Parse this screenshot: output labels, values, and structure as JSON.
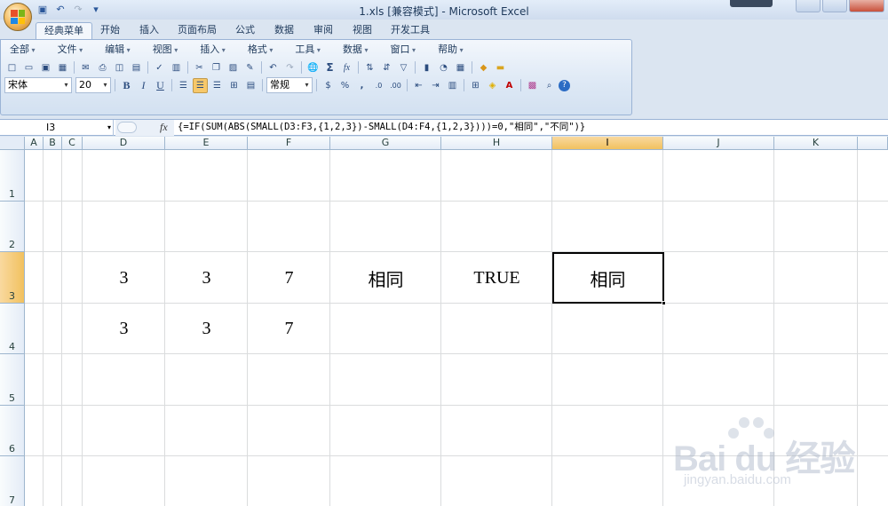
{
  "window": {
    "title": "1.xls  [兼容模式] - Microsoft Excel"
  },
  "ribbon_tabs": [
    "经典菜单",
    "开始",
    "插入",
    "页面布局",
    "公式",
    "数据",
    "审阅",
    "视图",
    "开发工具"
  ],
  "classic_menu": [
    "全部",
    "文件",
    "编辑",
    "视图",
    "插入",
    "格式",
    "工具",
    "数据",
    "窗口",
    "帮助"
  ],
  "format_bar": {
    "font_name": "宋体",
    "font_size": "20",
    "number_format": "常规"
  },
  "formula_bar": {
    "name_box": "I3",
    "fx_label": "fx",
    "formula": "{=IF(SUM(ABS(SMALL(D3:F3,{1,2,3})-SMALL(D4:F4,{1,2,3})))=0,\"相同\",\"不同\")}"
  },
  "sheet": {
    "columns": [
      "A",
      "B",
      "C",
      "D",
      "E",
      "F",
      "G",
      "H",
      "I",
      "J",
      "K"
    ],
    "rows": [
      "1",
      "2",
      "3",
      "4",
      "5",
      "6",
      "7"
    ],
    "selected_cell": "I3",
    "cells": {
      "D3": "3",
      "E3": "3",
      "F3": "7",
      "G3": "相同",
      "H3": "TRUE",
      "I3": "相同",
      "D4": "3",
      "E4": "3",
      "F4": "7"
    }
  },
  "watermark": {
    "brand": "Bai du 经验",
    "url": "jingyan.baidu.com"
  },
  "colors": {
    "ribbon_bg": "#dbe5f1",
    "header_selected": "#f1c15f",
    "grid_line": "#dadcdd"
  }
}
